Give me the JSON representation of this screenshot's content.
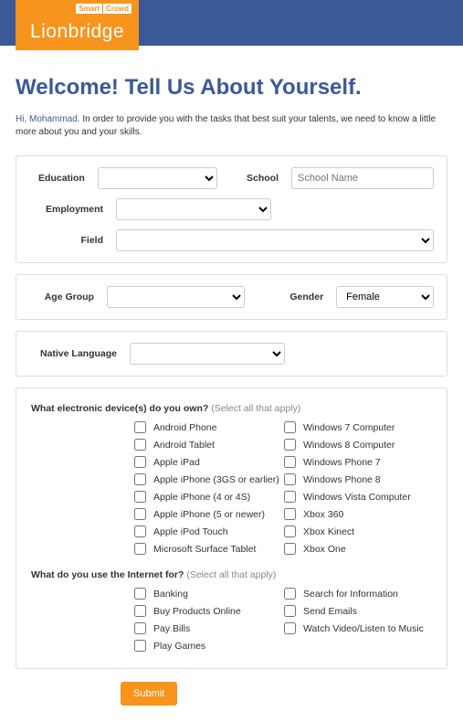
{
  "logo": {
    "brand": "Lionbridge",
    "badge1": "Smart",
    "badge2": "Crowd"
  },
  "page_title": "Welcome! Tell Us About Yourself.",
  "intro": {
    "greeting": "Hi, Mohammad.",
    "text": " In order to provide you with the tasks that best suit your talents, we need to know a little more about you and your skills."
  },
  "labels": {
    "education": "Education",
    "school": "School",
    "school_placeholder": "School Name",
    "employment": "Employment",
    "field": "Field",
    "age_group": "Age Group",
    "gender": "Gender",
    "native_language": "Native Language"
  },
  "values": {
    "gender": "Female"
  },
  "q1": {
    "title": "What electronic device(s) do you own?",
    "hint": "(Select all that apply)",
    "col1": [
      "Android Phone",
      "Android Tablet",
      "Apple iPad",
      "Apple iPhone (3GS or earlier)",
      "Apple iPhone (4 or 4S)",
      "Apple iPhone (5 or newer)",
      "Apple iPod Touch",
      "Microsoft Surface Tablet"
    ],
    "col2": [
      "Windows 7 Computer",
      "Windows 8 Computer",
      "Windows Phone 7",
      "Windows Phone 8",
      "Windows Vista Computer",
      "Xbox 360",
      "Xbox Kinect",
      "Xbox One"
    ]
  },
  "q2": {
    "title": "What do you use the Internet for?",
    "hint": "(Select all that apply)",
    "col1": [
      "Banking",
      "Buy Products Online",
      "Pay Bills",
      "Play Games"
    ],
    "col2": [
      "Search for Information",
      "Send Emails",
      "Watch Video/Listen to Music"
    ]
  },
  "submit": "Submit"
}
